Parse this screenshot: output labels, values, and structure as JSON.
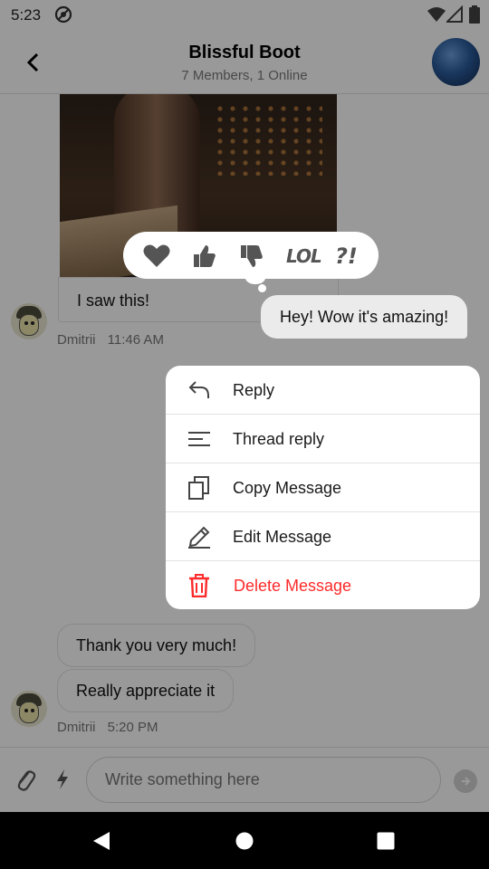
{
  "status_bar": {
    "time": "5:23"
  },
  "header": {
    "title": "Blissful Boot",
    "subtitle": "7 Members, 1 Online"
  },
  "messages": {
    "caption": "I saw this!",
    "caption_sender": "Dmitrii",
    "caption_time": "11:46 AM",
    "own_message": "Hey! Wow it's amazing!",
    "thanks": "Thank you very much!",
    "appreciate": "Really appreciate it",
    "last_sender": "Dmitrii",
    "last_time": "5:20 PM"
  },
  "composer": {
    "placeholder": "Write something here"
  },
  "reactions": [
    {
      "icon": "heart-icon"
    },
    {
      "icon": "thumbs-up-icon"
    },
    {
      "icon": "thumbs-down-icon"
    },
    {
      "icon": "lol-icon",
      "text": "LOL"
    },
    {
      "icon": "wut-icon",
      "text": "?!"
    }
  ],
  "context_menu": {
    "reply": "Reply",
    "thread_reply": "Thread reply",
    "copy": "Copy Message",
    "edit": "Edit Message",
    "delete": "Delete Message"
  },
  "colors": {
    "danger": "#ff2a2a",
    "overlay": "rgba(0,0,0,0.40)"
  }
}
